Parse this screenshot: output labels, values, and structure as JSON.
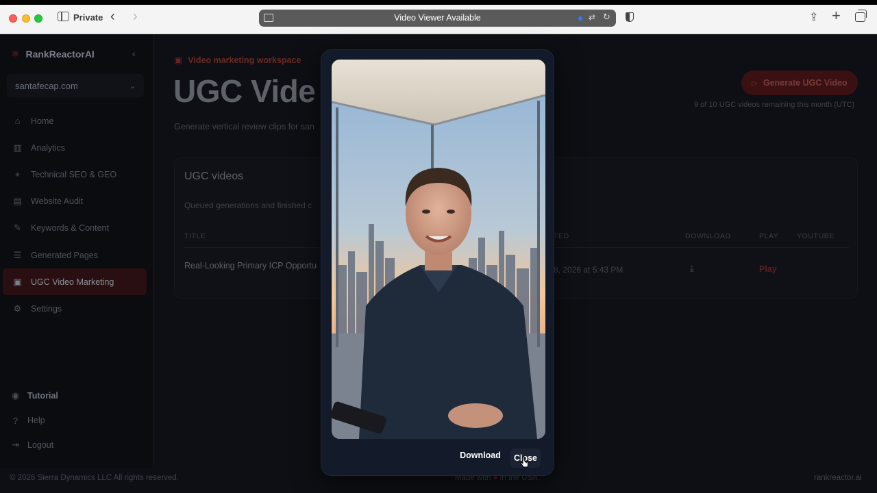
{
  "browser": {
    "mode_label": "Private",
    "address_text": "Video Viewer Available"
  },
  "app": {
    "brand": "RankReactorAI",
    "workspace": "santafecap.com",
    "nav": [
      {
        "label": "Home",
        "icon": "home-icon"
      },
      {
        "label": "Analytics",
        "icon": "analytics-icon"
      },
      {
        "label": "Technical SEO & GEO",
        "icon": "scan-icon"
      },
      {
        "label": "Website Audit",
        "icon": "clipboard-icon"
      },
      {
        "label": "Keywords & Content",
        "icon": "pencil-icon"
      },
      {
        "label": "Generated Pages",
        "icon": "pages-icon"
      },
      {
        "label": "UGC Video Marketing",
        "icon": "clapperboard-icon",
        "active": true
      },
      {
        "label": "Settings",
        "icon": "gear-icon"
      }
    ],
    "bottom_nav": {
      "tutorial": "Tutorial",
      "help": "Help",
      "logout": "Logout"
    },
    "footer": {
      "copyright": "© 2026 Sierra Dynamics LLC All rights reserved.",
      "made_with_prefix": "Made with",
      "made_with_suffix": "in the USA",
      "domain": "rankreactor.ai"
    }
  },
  "main": {
    "eyebrow": "Video marketing workspace",
    "title": "UGC Vide",
    "subtitle": "Generate vertical review clips for san",
    "generate_button": "Generate UGC Video",
    "quota": "9 of 10 UGC videos remaining this month (UTC)",
    "card": {
      "title": "UGC videos",
      "subtitle": "Queued generations and finished c",
      "columns": {
        "title": "TITLE",
        "created": "TED",
        "download": "DOWNLOAD",
        "play": "PLAY",
        "youtube": "YOUTUBE"
      },
      "rows": [
        {
          "title": "Real-Looking Primary ICP Opportu",
          "created": "8, 2026 at 5:43 PM",
          "play": "Play"
        }
      ]
    }
  },
  "modal": {
    "download_label": "Download",
    "close_label": "Close"
  },
  "colors": {
    "accent": "#e0393e",
    "modal_bg": "#131a2a"
  }
}
